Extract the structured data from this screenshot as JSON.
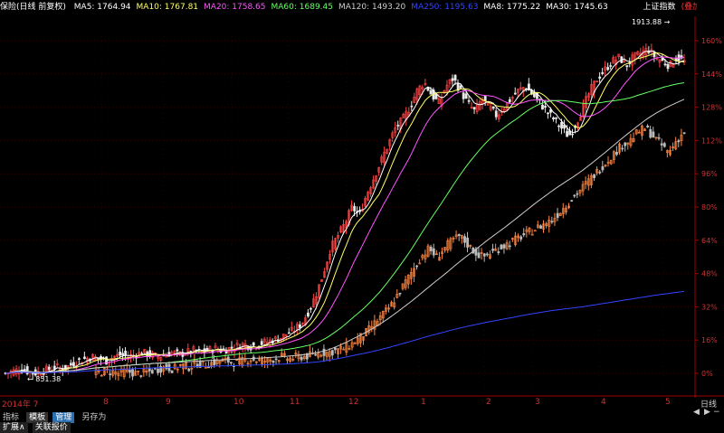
{
  "legend": {
    "title": "保险(日线 前复权)",
    "items": [
      {
        "label": "MA5: 1764.94",
        "color": "#ffffff"
      },
      {
        "label": "MA10: 1767.81",
        "color": "#ffff66"
      },
      {
        "label": "MA20: 1758.65",
        "color": "#ff55ff"
      },
      {
        "label": "MA60: 1689.45",
        "color": "#66ff66"
      },
      {
        "label": "MA120: 1493.20",
        "color": "#cccccc"
      },
      {
        "label": "MA250: 1195.63",
        "color": "#3344ff"
      },
      {
        "label": "MA8: 1775.22",
        "color": "#ffffff"
      },
      {
        "label": "MA30: 1745.63",
        "color": "#ffffff"
      }
    ],
    "ref_label": "上证指数",
    "ref_suffix": "(叠加前复权)"
  },
  "chart_data": {
    "type": "candlestick",
    "y_axis_ticks": [
      "160%",
      "144%",
      "128%",
      "112%",
      "96%",
      "80%",
      "64%",
      "48%",
      "32%",
      "16%",
      "0%"
    ],
    "y_range": [
      0,
      160
    ],
    "month_labels": [
      "2014年 7",
      "8",
      "9",
      "10",
      "11",
      "12",
      "1",
      "2",
      "3",
      "4",
      "5"
    ],
    "annotations": [
      {
        "text": "1913.88",
        "type": "high"
      },
      {
        "text": "851.38",
        "type": "low"
      }
    ],
    "axis_label": "日线",
    "series": [
      {
        "name": "MA5",
        "color": "#ffffff"
      },
      {
        "name": "MA10",
        "color": "#ffff66"
      },
      {
        "name": "MA20",
        "color": "#ff55ff"
      },
      {
        "name": "MA60",
        "color": "#66ff66"
      },
      {
        "name": "MA120",
        "color": "#cccccc"
      },
      {
        "name": "MA250",
        "color": "#3344ff"
      }
    ],
    "price_pct": [
      0,
      1,
      2,
      1,
      0,
      1,
      2,
      3,
      2,
      4,
      6,
      7,
      8,
      7,
      6,
      8,
      9,
      8,
      9,
      10,
      9,
      8,
      9,
      10,
      9,
      10,
      11,
      10,
      11,
      12,
      11,
      12,
      13,
      14,
      13,
      14,
      15,
      16,
      17,
      19,
      21,
      24,
      30,
      38,
      48,
      60,
      66,
      72,
      80,
      76,
      86,
      94,
      102,
      110,
      118,
      122,
      128,
      136,
      140,
      134,
      130,
      138,
      142,
      136,
      130,
      126,
      132,
      128,
      124,
      128,
      132,
      136,
      138,
      134,
      130,
      126,
      122,
      118,
      114,
      120,
      128,
      136,
      142,
      146,
      150,
      152,
      148,
      152,
      154,
      156,
      152,
      150,
      148,
      152,
      150
    ],
    "ref_pct": [
      0,
      1,
      1,
      0,
      1,
      0,
      0,
      1,
      2,
      3,
      2,
      4,
      3,
      5,
      4,
      5,
      6,
      6,
      5,
      6,
      7,
      6,
      6,
      7,
      8,
      7,
      8,
      8,
      9,
      10,
      10,
      11,
      12,
      14,
      17,
      20,
      24,
      28,
      32,
      38,
      44,
      50,
      56,
      60,
      56,
      60,
      64,
      66,
      62,
      58,
      56,
      58,
      60,
      62,
      64,
      66,
      68,
      70,
      72,
      74,
      78,
      82,
      86,
      90,
      94,
      98,
      102,
      106,
      110,
      112,
      116,
      118,
      114,
      110,
      106,
      112,
      116
    ]
  },
  "bottom": {
    "tabs": [
      "指标",
      "模板",
      "管理",
      "另存为"
    ],
    "tabs2": [
      "扩展∧",
      "关联报价"
    ]
  }
}
